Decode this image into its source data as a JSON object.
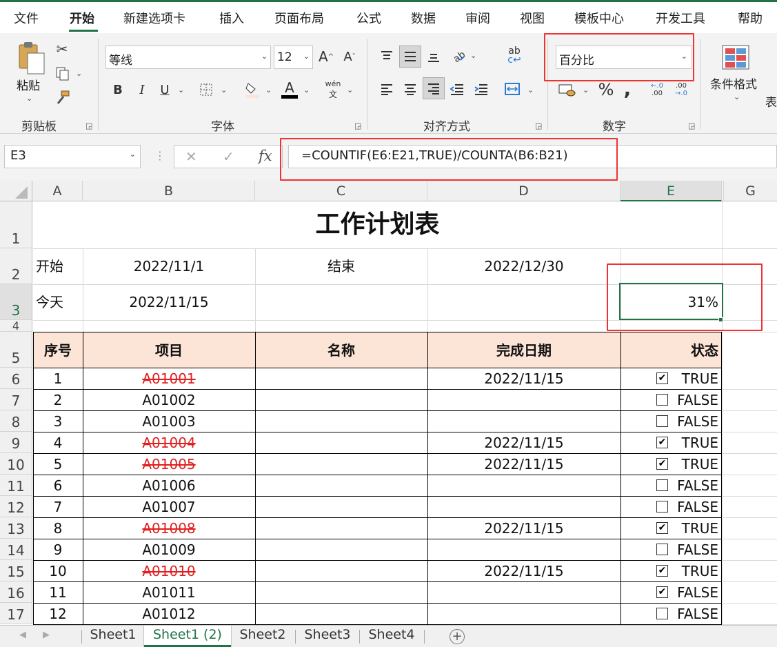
{
  "menu": {
    "tabs": [
      "文件",
      "开始",
      "新建选项卡",
      "插入",
      "页面布局",
      "公式",
      "数据",
      "审阅",
      "视图",
      "模板中心",
      "开发工具",
      "帮助"
    ],
    "active_index": 1
  },
  "ribbon": {
    "clipboard": {
      "label": "剪贴板",
      "paste": "粘贴"
    },
    "font": {
      "label": "字体",
      "name": "等线",
      "size": "12",
      "phonetic": "wén"
    },
    "alignment": {
      "label": "对齐方式"
    },
    "number": {
      "label": "数字",
      "format": "百分比"
    },
    "styles": {
      "conditional_format": "条件格式",
      "table_partial": "表"
    }
  },
  "formula_bar": {
    "name_box": "E3",
    "formula": "=COUNTIF(E6:E21,TRUE)/COUNTA(B6:B21)"
  },
  "columns": [
    "A",
    "B",
    "C",
    "D",
    "E",
    "G"
  ],
  "selected_column": "E",
  "rows": [
    "1",
    "2",
    "3",
    "4",
    "5",
    "6",
    "7",
    "8",
    "9",
    "10",
    "11",
    "12",
    "13",
    "14",
    "15",
    "16",
    "17"
  ],
  "selected_row": "3",
  "sheet": {
    "title": "工作计划表",
    "start_label": "开始",
    "start_date": "2022/11/1",
    "end_label": "结束",
    "end_date": "2022/12/30",
    "today_label": "今天",
    "today_date": "2022/11/15",
    "progress": "31%",
    "headers": [
      "序号",
      "项目",
      "名称",
      "完成日期",
      "状态"
    ],
    "header_fill": "#fce4d6",
    "tasks": [
      {
        "no": "1",
        "item": "A01001",
        "done_date": "2022/11/15",
        "checked": true,
        "status": "TRUE"
      },
      {
        "no": "2",
        "item": "A01002",
        "done_date": "",
        "checked": false,
        "status": "FALSE"
      },
      {
        "no": "3",
        "item": "A01003",
        "done_date": "",
        "checked": false,
        "status": "FALSE"
      },
      {
        "no": "4",
        "item": "A01004",
        "done_date": "2022/11/15",
        "checked": true,
        "status": "TRUE"
      },
      {
        "no": "5",
        "item": "A01005",
        "done_date": "2022/11/15",
        "checked": true,
        "status": "TRUE"
      },
      {
        "no": "6",
        "item": "A01006",
        "done_date": "",
        "checked": false,
        "status": "FALSE"
      },
      {
        "no": "7",
        "item": "A01007",
        "done_date": "",
        "checked": false,
        "status": "FALSE"
      },
      {
        "no": "8",
        "item": "A01008",
        "done_date": "2022/11/15",
        "checked": true,
        "status": "TRUE"
      },
      {
        "no": "9",
        "item": "A01009",
        "done_date": "",
        "checked": false,
        "status": "FALSE"
      },
      {
        "no": "10",
        "item": "A01010",
        "done_date": "2022/11/15",
        "checked": true,
        "status": "TRUE"
      },
      {
        "no": "11",
        "item": "A01011",
        "done_date": "",
        "checked": true,
        "status": "FALSE"
      },
      {
        "no": "12",
        "item": "A01012",
        "done_date": "",
        "checked": false,
        "status": "FALSE"
      }
    ]
  },
  "sheet_tabs": [
    "Sheet1",
    "Sheet1 (2)",
    "Sheet2",
    "Sheet3",
    "Sheet4"
  ],
  "active_sheet_index": 1,
  "colors": {
    "accent": "#217346",
    "highlight_box": "#e33333",
    "strike": "#e02020"
  }
}
